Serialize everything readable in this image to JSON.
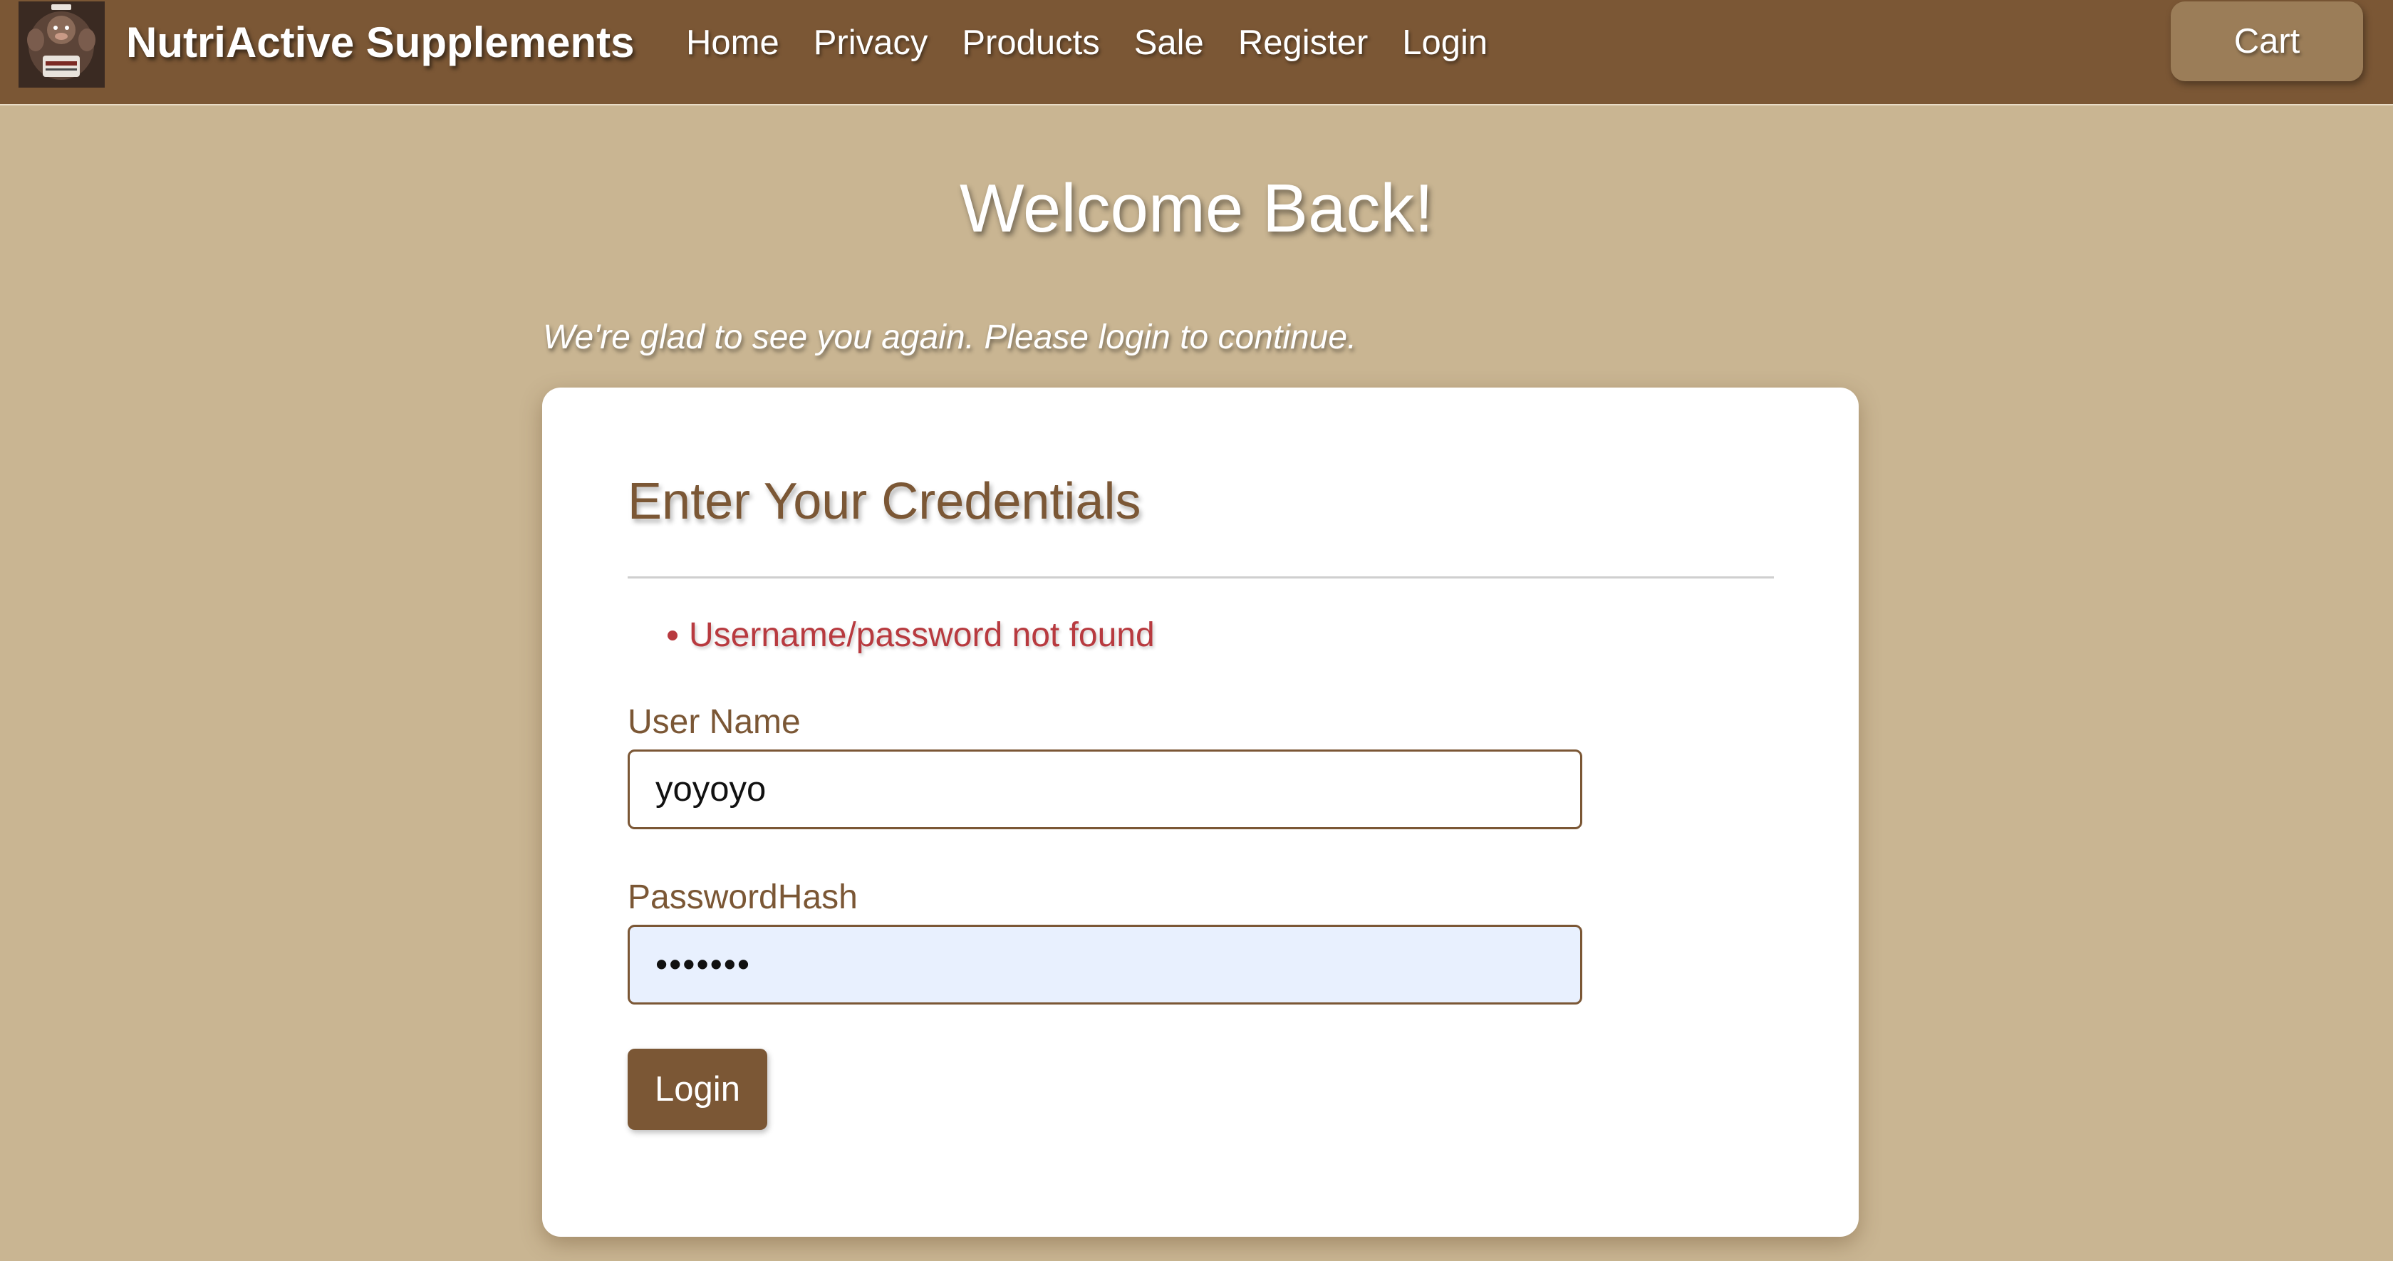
{
  "navbar": {
    "brand": "NutriActive Supplements",
    "logo_icon": "gorilla-mascot-logo-icon",
    "links": [
      {
        "label": "Home"
      },
      {
        "label": "Privacy"
      },
      {
        "label": "Products"
      },
      {
        "label": "Sale"
      },
      {
        "label": "Register"
      },
      {
        "label": "Login"
      }
    ],
    "cart_label": "Cart"
  },
  "page": {
    "title": "Welcome Back!",
    "subtitle": "We're glad to see you again. Please login to continue."
  },
  "form": {
    "heading": "Enter Your Credentials",
    "errors": [
      "Username/password not found"
    ],
    "username_label": "User Name",
    "username_value": "yoyoyo",
    "password_label": "PasswordHash",
    "password_value": "•••••••",
    "submit_label": "Login"
  },
  "colors": {
    "background": "#c9b592",
    "navbar": "#7b5735",
    "accent": "#7b5735",
    "error": "#b83a3f",
    "autofill": "#e8f0fe"
  }
}
